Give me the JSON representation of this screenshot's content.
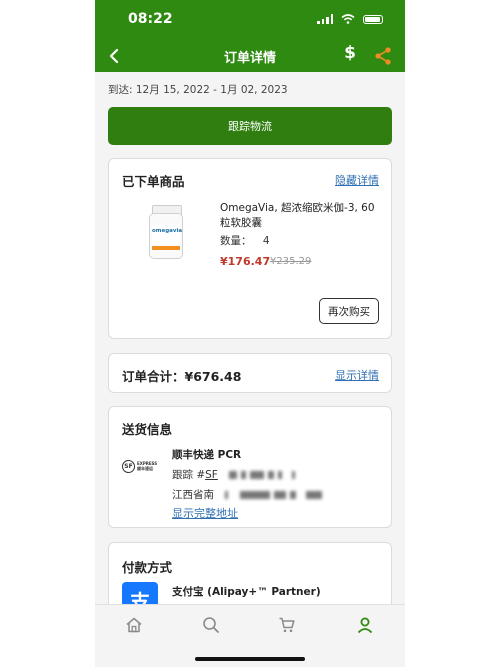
{
  "status_bar": {
    "time": "08:22"
  },
  "nav": {
    "title": "订单详情",
    "dollar_label": "$"
  },
  "delivery_text": "到达: 12月 15, 2022 - 1月 02, 2023",
  "track_button": "跟踪物流",
  "order_items": {
    "title": "已下单商品",
    "hide_link": "隐藏详情",
    "product": {
      "name": "OmegaVia, 超浓缩欧米伽-3, 60粒软胶囊",
      "image_brand": "omegavia",
      "quantity_label": "数量：",
      "quantity": "4",
      "price": "¥176.47",
      "original_price": "¥235.29"
    },
    "buy_again": "再次购买"
  },
  "order_total": {
    "label": "订单合计：¥676.48",
    "show_link": "显示详情"
  },
  "shipping": {
    "title": "送货信息",
    "carrier": "顺丰快递 PCR",
    "tracking_prefix": "跟踪 #",
    "tracking_code": "SF",
    "address_prefix": "江西省南",
    "show_address": "显示完整地址",
    "logo_letters": "SF",
    "logo_text_1": "EXPRESS",
    "logo_text_2": "顺丰速运"
  },
  "payment": {
    "title": "付款方式",
    "icon_char": "支",
    "method": "支付宝 (Alipay+™ Partner)"
  },
  "colors": {
    "brand_green": "#2f8a11",
    "button_green": "#2f7e0f",
    "link_blue": "#2f6fb3",
    "price_red": "#c0392b"
  },
  "tab_bar": [
    "home-icon",
    "search-icon",
    "cart-icon",
    "account-icon"
  ]
}
